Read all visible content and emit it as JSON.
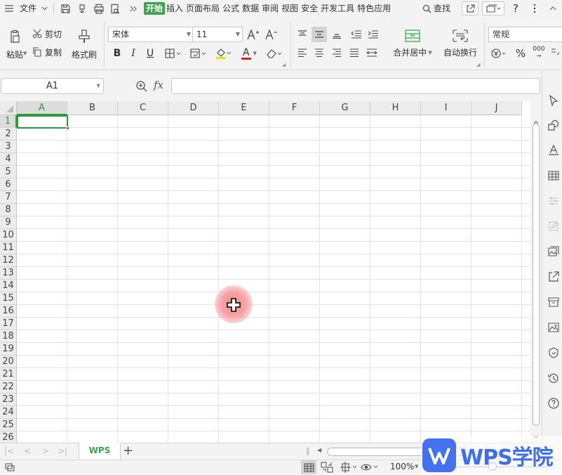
{
  "menubar": {
    "file": "文件",
    "tabs": [
      "插入",
      "页面布局",
      "公式",
      "数据",
      "审阅",
      "视图",
      "安全",
      "开发工具",
      "特色应用"
    ],
    "active_tab": "开始",
    "search": "查找",
    "help": "?"
  },
  "ribbon": {
    "paste": "粘贴",
    "cut": "剪切",
    "copy": "复制",
    "format_painter": "格式刷",
    "font_name": "宋体",
    "font_size": "11",
    "bold": "B",
    "italic": "I",
    "underline": "U",
    "font_color_letter": "A",
    "merge_center": "合并居中",
    "wrap_text": "自动换行",
    "number_format": "常规",
    "percent": "%",
    "thousands": "000"
  },
  "formula_bar": {
    "name_box": "A1",
    "fx": "fx",
    "formula": ""
  },
  "grid": {
    "columns": [
      "A",
      "B",
      "C",
      "D",
      "E",
      "F",
      "G",
      "H",
      "I",
      "J"
    ],
    "rows": [
      "1",
      "2",
      "3",
      "4",
      "5",
      "6",
      "7",
      "8",
      "9",
      "10",
      "11",
      "12",
      "13",
      "14",
      "15",
      "16",
      "17",
      "18",
      "19",
      "20",
      "21",
      "22",
      "23",
      "24",
      "25",
      "26"
    ],
    "selected_cell": "A1"
  },
  "sheets": {
    "tabs": [
      "WPS"
    ],
    "active": "WPS",
    "add": "+"
  },
  "status": {
    "zoom": "100%"
  },
  "watermark": {
    "text": "WPS学院"
  },
  "colors": {
    "accent": "#3aa54a",
    "selection": "#2e9a3e",
    "toolbar_bg": "#f3f3f3",
    "header_bg": "#ececec",
    "cursor_highlight": "#f6a3a7",
    "watermark_blue": "#3d6df2"
  }
}
